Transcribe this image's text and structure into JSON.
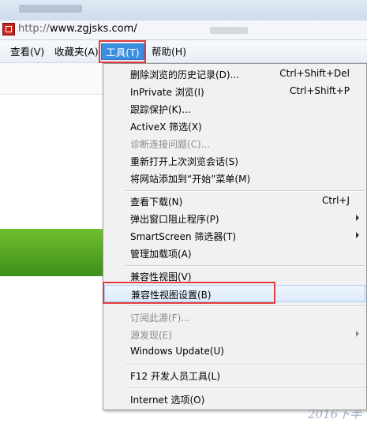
{
  "address": {
    "protocol": "http://",
    "host": "www.zgjsks.com/"
  },
  "menubar": {
    "items": [
      {
        "label": "查看(V)"
      },
      {
        "label": "收藏夹(A)"
      },
      {
        "label": "工具(T)"
      },
      {
        "label": "帮助(H)"
      }
    ]
  },
  "tools_menu": {
    "items": [
      {
        "label": "删除浏览的历史记录(D)...",
        "shortcut": "Ctrl+Shift+Del"
      },
      {
        "label": "InPrivate 浏览(I)",
        "shortcut": "Ctrl+Shift+P"
      },
      {
        "label": "跟踪保护(K)..."
      },
      {
        "label": "ActiveX 筛选(X)"
      },
      {
        "label": "诊断连接问题(C)...",
        "disabled": true
      },
      {
        "label": "重新打开上次浏览会话(S)"
      },
      {
        "label": "将网站添加到“开始”菜单(M)"
      },
      {
        "label": "查看下载(N)",
        "shortcut": "Ctrl+J"
      },
      {
        "label": "弹出窗口阻止程序(P)",
        "submenu": true
      },
      {
        "label": "SmartScreen 筛选器(T)",
        "submenu": true
      },
      {
        "label": "管理加载项(A)"
      },
      {
        "label": "兼容性视图(V)"
      },
      {
        "label": "兼容性视图设置(B)",
        "hovered": true
      },
      {
        "label": "订阅此源(F)...",
        "disabled": true
      },
      {
        "label": "源发现(E)",
        "disabled": true,
        "submenu": true
      },
      {
        "label": "Windows Update(U)"
      },
      {
        "label": "F12 开发人员工具(L)"
      },
      {
        "label": "Internet 选项(O)"
      }
    ]
  },
  "page": {
    "corner_text": "2016下半"
  },
  "colors": {
    "highlight_border": "#e23c3c",
    "menu_selected": "#3b8fe0",
    "banner_green": "#5aa824"
  }
}
